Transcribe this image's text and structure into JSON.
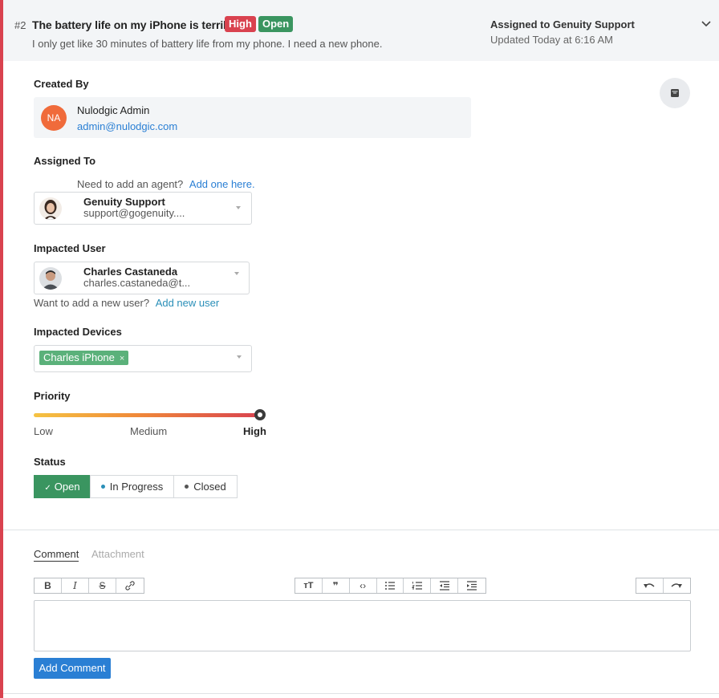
{
  "ticket": {
    "number": "#2",
    "title": "The battery life on my iPhone is terrible.",
    "priority_badge": "High",
    "status_badge": "Open",
    "description": "I only get like 30 minutes of battery life from my phone.  I need a new phone.",
    "assigned_summary": "Assigned to Genuity Support",
    "updated": "Updated Today at 6:16 AM"
  },
  "created_by": {
    "label": "Created By",
    "initials": "NA",
    "name": "Nulodgic Admin",
    "email": "admin@nulodgic.com"
  },
  "assigned_to": {
    "label": "Assigned To",
    "hint": "Need to add an agent?",
    "hint_link": "Add one here.",
    "name": "Genuity Support",
    "email": "support@gogenuity...."
  },
  "impacted_user": {
    "label": "Impacted User",
    "name": "Charles Castaneda",
    "email": "charles.castaneda@t...",
    "hint": "Want to add a new user?",
    "hint_link": "Add new user"
  },
  "impacted_devices": {
    "label": "Impacted Devices",
    "chips": [
      {
        "label": "Charles iPhone",
        "remove": "×"
      }
    ]
  },
  "priority": {
    "label": "Priority",
    "levels": [
      "Low",
      "Medium",
      "High"
    ],
    "selected": "High",
    "value_fraction": 1.0
  },
  "status": {
    "label": "Status",
    "options": [
      {
        "label": "Open",
        "active": true
      },
      {
        "label": "In Progress",
        "active": false
      },
      {
        "label": "Closed",
        "active": false
      }
    ]
  },
  "comment": {
    "tabs": [
      {
        "label": "Comment",
        "active": true
      },
      {
        "label": "Attachment",
        "active": false
      }
    ],
    "toolbar_icons": [
      "bold-icon",
      "italic-icon",
      "strikethrough-icon",
      "link-icon",
      "heading-icon",
      "quote-icon",
      "code-icon",
      "bullet-list-icon",
      "numbered-list-icon",
      "outdent-icon",
      "indent-icon",
      "undo-icon",
      "redo-icon"
    ],
    "submit_label": "Add Comment"
  },
  "colors": {
    "accent_red": "#d9424f",
    "accent_green": "#3a9560",
    "link_blue": "#2a7fd4"
  }
}
